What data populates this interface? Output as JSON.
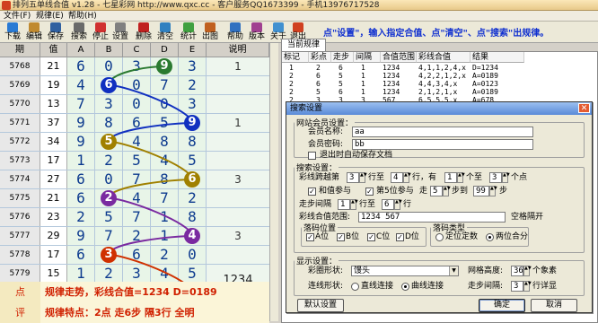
{
  "window": {
    "title": "排列五单线合值 v1.28 - 七星彩网 http://www.qxc.cc - 客户服务QQ1673399 - 手机13976717528"
  },
  "menu": [
    "文件(F)",
    "规律(E)",
    "帮助(H)"
  ],
  "toolbar": [
    {
      "label": "下载",
      "icon": "download-icon",
      "color": "#2a7bd4"
    },
    {
      "label": "编辑",
      "icon": "edit-icon",
      "color": "#c08a30"
    },
    {
      "label": "保存",
      "icon": "save-icon",
      "color": "#3060a0"
    },
    {
      "label": "搜索",
      "icon": "search-icon",
      "color": "#6a6a6a"
    },
    {
      "label": "停止",
      "icon": "stop-icon",
      "color": "#d03030"
    },
    {
      "label": "设置",
      "icon": "settings-icon",
      "color": "#808080"
    },
    {
      "label": "删除",
      "icon": "delete-icon",
      "color": "#c02020"
    },
    {
      "label": "清空",
      "icon": "clear-icon",
      "color": "#3080c0"
    },
    {
      "label": "统计",
      "icon": "stats-icon",
      "color": "#40a040"
    },
    {
      "label": "出图",
      "icon": "chart-icon",
      "color": "#c06020"
    },
    {
      "label": "帮助",
      "icon": "help-icon",
      "color": "#3070c0"
    },
    {
      "label": "版本",
      "icon": "version-icon",
      "color": "#a04090"
    },
    {
      "label": "关于",
      "icon": "about-icon",
      "color": "#4090d0"
    },
    {
      "label": "退出",
      "icon": "exit-icon",
      "color": "#d04020"
    }
  ],
  "hint": "点\"设置\"，输入指定合值、点\"清空\"、点\"搜索\"出规律。",
  "grid": {
    "headers": [
      "期",
      "值",
      "A",
      "B",
      "C",
      "D",
      "E",
      "说明"
    ],
    "rows": [
      {
        "period": "5768",
        "value": "21",
        "digits": [
          "6",
          "0",
          "3",
          "9",
          "3"
        ],
        "ball": 3,
        "note": "1"
      },
      {
        "period": "5769",
        "value": "19",
        "digits": [
          "4",
          "6",
          "0",
          "7",
          "2"
        ],
        "ball": 1,
        "note": ""
      },
      {
        "period": "5770",
        "value": "13",
        "digits": [
          "7",
          "3",
          "0",
          "0",
          "3"
        ],
        "ball": -1,
        "note": ""
      },
      {
        "period": "5771",
        "value": "37",
        "digits": [
          "9",
          "8",
          "6",
          "5",
          "9"
        ],
        "ball": 3,
        "note": "1"
      },
      {
        "period": "5772",
        "value": "34",
        "digits": [
          "9",
          "5",
          "4",
          "8",
          "8"
        ],
        "ball": 1,
        "note": ""
      },
      {
        "period": "5773",
        "value": "17",
        "digits": [
          "1",
          "2",
          "5",
          "4",
          "5"
        ],
        "ball": -1,
        "note": ""
      },
      {
        "period": "5774",
        "value": "27",
        "digits": [
          "6",
          "0",
          "7",
          "8",
          "6"
        ],
        "ball": 3,
        "note": "3"
      },
      {
        "period": "5775",
        "value": "21",
        "digits": [
          "6",
          "2",
          "4",
          "7",
          "2"
        ],
        "ball": 1,
        "note": ""
      },
      {
        "period": "5776",
        "value": "23",
        "digits": [
          "2",
          "5",
          "7",
          "1",
          "8"
        ],
        "ball": -1,
        "note": ""
      },
      {
        "period": "5777",
        "value": "29",
        "digits": [
          "9",
          "7",
          "2",
          "1",
          "4"
        ],
        "ball": 3,
        "note": "3"
      },
      {
        "period": "5778",
        "value": "17",
        "digits": [
          "6",
          "3",
          "6",
          "2",
          "0"
        ],
        "ball": 1,
        "note": ""
      },
      {
        "period": "5779",
        "value": "15",
        "digits": [
          "1",
          "2",
          "3",
          "4",
          "5"
        ],
        "ball": -1,
        "note": ""
      }
    ],
    "ball_colors": [
      "#2a7a30",
      "#1030c0",
      "#a08000",
      "#7a2aa0",
      "#d03000"
    ],
    "next_row_ball": {
      "digit": "5",
      "col": 4
    },
    "footer_input": "1234"
  },
  "bottom_note": {
    "line1_label": "点",
    "line1": "规律走势，彩线合值=1234  D=0189",
    "line2_label": "评",
    "line2": "规律特点：2点  走6步  隔3行  全明"
  },
  "rules_panel": {
    "tab": "当前规律",
    "columns": [
      "标记",
      "彩点",
      "走步",
      "间隔",
      "合值范围",
      "彩线合值",
      "结果"
    ],
    "rows": [
      [
        "1",
        "2",
        "6",
        "1",
        "1234",
        "4,1,1,2,4,x",
        "D=1234"
      ],
      [
        "2",
        "6",
        "5",
        "1",
        "1234",
        "4,2,2,1,2,x",
        "A=0189"
      ],
      [
        "2",
        "6",
        "5",
        "1",
        "1234",
        "4,4,3,4,x",
        "A=0123"
      ],
      [
        "2",
        "5",
        "6",
        "1",
        "1234",
        "2,1,2,1,x",
        "A=0189"
      ],
      [
        "2",
        "3",
        "3",
        "3",
        "567",
        "6,5,5,5,x",
        "A=678"
      ]
    ]
  },
  "dialog": {
    "title": "搜索设置",
    "member": {
      "legend": "网站会员设置：",
      "name_label": "会员名称:",
      "name_value": "aa",
      "pwd_label": "会员密码:",
      "pwd_value": "bb",
      "autosave": "退出时自动保存文档"
    },
    "search": {
      "legend": "搜索设置：",
      "span_label": "彩线跨越第",
      "span_from": "3",
      "span_row": "行至",
      "span_to": "4",
      "span_row2": "行，有",
      "span_pts_from": "1",
      "span_to_lbl": "个至",
      "span_pts_to": "3",
      "span_pts_lbl": "个点",
      "sum_cb": "和值参与",
      "fifth_cb": "第5位参与",
      "walk_lbl": "走",
      "walk_from": "5",
      "walk_to_lbl": "步到",
      "walk_to": "99",
      "walk_unit": "步",
      "gap_lbl": "走步间隔",
      "gap_from": "1",
      "gap_to_lbl": "行至",
      "gap_to": "6",
      "gap_unit": "行",
      "range_lbl": "彩线合值范围:",
      "range_value": "1234 567",
      "range_note": "空格隔开",
      "pos_legend": "落码位置",
      "pos": [
        "A位",
        "B位",
        "C位",
        "D位"
      ],
      "type_legend": "落码类型",
      "type_opts": [
        "定位定数",
        "两位合分"
      ]
    },
    "display": {
      "legend": "显示设置：",
      "shape_lbl": "彩圈形状:",
      "shape_value": "馒头",
      "height_lbl": "网格高度:",
      "height_value": "36",
      "height_unit": "个象素",
      "line_lbl": "连线形状:",
      "line_opts": [
        "直线连接",
        "曲线连接"
      ],
      "step_lbl": "走步间隔:",
      "step_value": "3",
      "step_unit": "行详显"
    },
    "buttons": {
      "default": "默认设置",
      "ok": "确定",
      "cancel": "取消"
    }
  }
}
